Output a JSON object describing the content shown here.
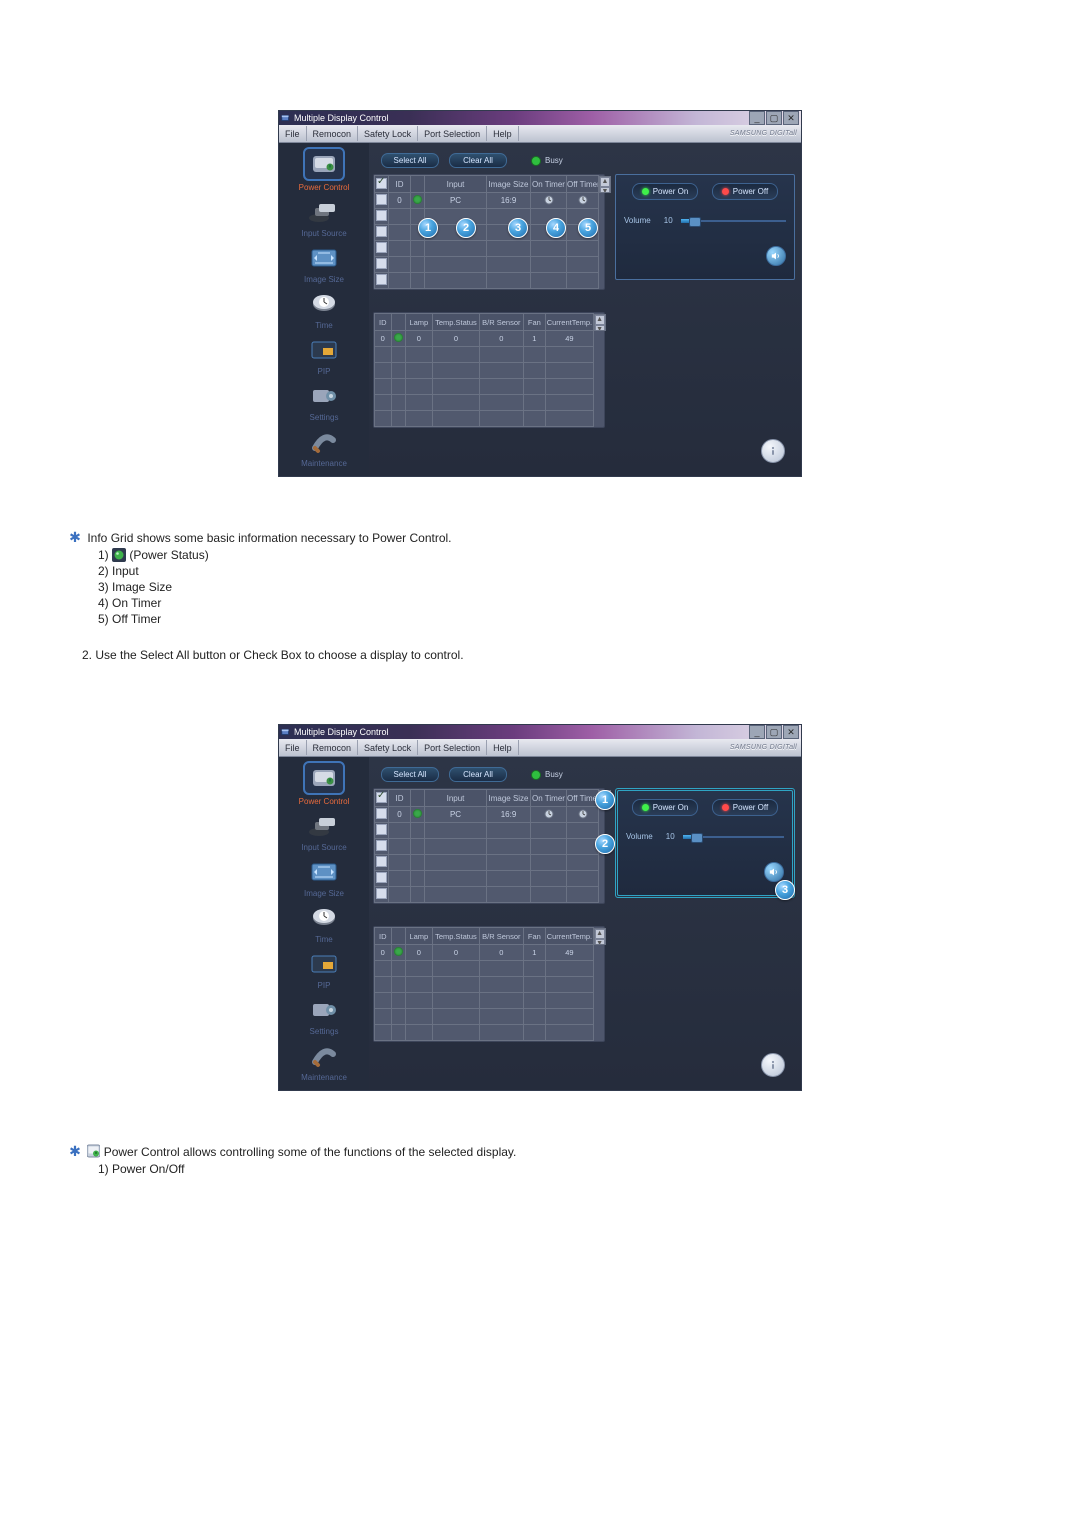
{
  "app": {
    "title": "Multiple Display Control",
    "brand": "SAMSUNG DIGITall",
    "menu": [
      "File",
      "Remocon",
      "Safety Lock",
      "Port Selection",
      "Help"
    ],
    "winbtns": {
      "min": "_",
      "max": "▢",
      "close": "✕"
    }
  },
  "sidebar": [
    {
      "label": "Power Control",
      "active": true
    },
    {
      "label": "Input Source",
      "active": false
    },
    {
      "label": "Image Size",
      "active": false
    },
    {
      "label": "Time",
      "active": false
    },
    {
      "label": "PIP",
      "active": false
    },
    {
      "label": "Settings",
      "active": false
    },
    {
      "label": "Maintenance",
      "active": false
    }
  ],
  "toolbar": {
    "select_all": "Select All",
    "clear_all": "Clear All",
    "busy": "Busy"
  },
  "infogrid": {
    "headers": {
      "cb": "",
      "id": "ID",
      "status": "",
      "input": "Input",
      "image_size": "Image Size",
      "on_timer": "On Timer",
      "off_timer": "Off Timer"
    },
    "rows": [
      {
        "cb": false,
        "id": "0",
        "status": true,
        "input": "PC",
        "image_size": "16:9",
        "on_timer_icon": true,
        "off_timer_icon": true
      }
    ]
  },
  "statusgrid": {
    "headers": {
      "id": "ID",
      "st": "",
      "lamp": "Lamp",
      "temp": "Temp.Status",
      "bw": "B/R Sensor",
      "fan": "Fan",
      "ct": "CurrentTemp."
    },
    "rows": [
      {
        "id": "0",
        "st": true,
        "lamp": "0",
        "temp": "0",
        "bw": "0",
        "fan": "1",
        "ct": "49"
      }
    ]
  },
  "ctrl": {
    "power_on": "Power On",
    "power_off": "Power Off",
    "volume_label": "Volume",
    "volume_value": "10"
  },
  "callouts_a": {
    "c1": "1",
    "c2": "2",
    "c3": "3",
    "c4": "4",
    "c5": "5"
  },
  "callouts_b": {
    "c1": "1",
    "c2": "2",
    "c3": "3"
  },
  "doc": {
    "info_grid_intro": "Info Grid shows some basic information necessary to Power Control.",
    "list1": {
      "n1": "1)",
      "t1": "(Power Status)",
      "n2": "2) Input",
      "n3": "3) Image Size",
      "n4": "4) On Timer",
      "n5": "5) Off Timer"
    },
    "step2": "2.  Use the Select All button or Check Box to choose a display to control.",
    "pc_intro": "Power Control allows controlling some of the functions of the selected display.",
    "list2": {
      "n1": "1)  Power On/Off"
    }
  }
}
